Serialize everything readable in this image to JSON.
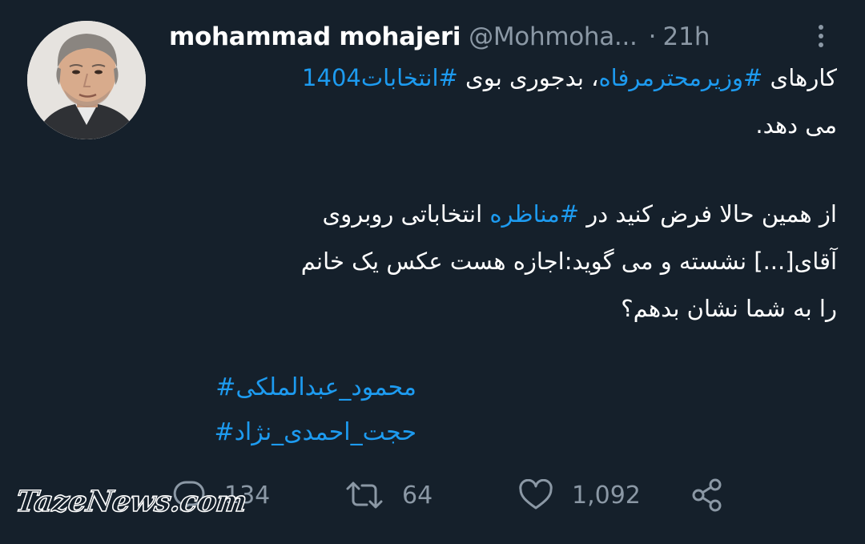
{
  "tweet": {
    "display_name": "mohammad mohajeri",
    "handle": "@Mohmoha...",
    "separator": "·",
    "time": "21h",
    "body": {
      "line1_prefix": "کارهای ",
      "line1_hashtag1": "#وزیرمحترمرفاه",
      "line1_mid": "، بدجوری بوی ",
      "line1_hashtag2": "#انتخابات1404",
      "line2": "می دهد.",
      "line3_prefix": "از همین حالا فرض کنید در ",
      "line3_hashtag": "#مناظره",
      "line3_suffix": " انتخاباتی روبروی",
      "line4": "آقای[...] نشسته و می گوید:اجازه هست عکس یک خانم",
      "line5": "را به شما نشان بدهم؟"
    },
    "hashtags": [
      "محمود_عبدالملکی#",
      "حجت_احمدی_نژاد#"
    ],
    "actions": {
      "reply_count": "134",
      "retweet_count": "64",
      "like_count": "1,092"
    },
    "icons": {
      "more": "more-vertical-icon",
      "reply": "reply-icon",
      "retweet": "retweet-icon",
      "like": "heart-icon",
      "share": "share-icon"
    },
    "colors": {
      "background": "#15202b",
      "text": "#ffffff",
      "muted": "#8b98a5",
      "link": "#1d9bf0"
    }
  },
  "watermark": "TazeNews.com"
}
